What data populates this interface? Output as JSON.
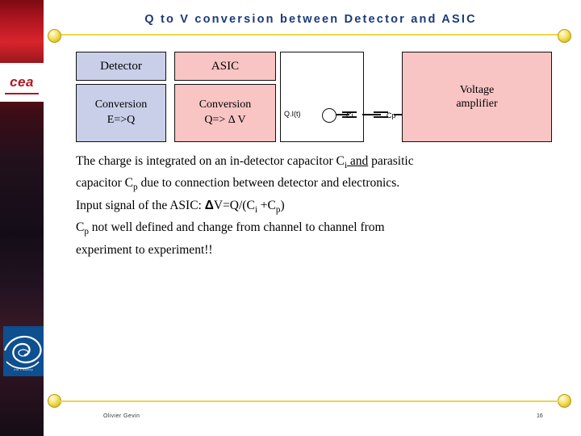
{
  "slide": {
    "title": "Q to V conversion between Detector and ASIC",
    "footer_author": "Olivier Gevin",
    "footer_page": "16"
  },
  "branding": {
    "cea_logo_text": "cea",
    "irfu_caption": "irfu    •    saclay"
  },
  "diagram": {
    "detector_header": "Detector",
    "asic_header": "ASIC",
    "detector_body_line1": "Conversion",
    "detector_body_line2": "E=>Q",
    "asic_body_line1": "Conversion",
    "asic_body_line2": "Q=> Δ V",
    "voltage_amp_line1": "Voltage",
    "voltage_amp_line2": "amplifier",
    "current_source_label": "Q.I(t)",
    "cap_i_label": "Ci",
    "cap_p_label": "Cp"
  },
  "body": {
    "p1_a": "The charge is integrated on an in-detector capacitor C",
    "p1_sub1": "i",
    "p1_b": " and",
    "p1_c": " parasitic",
    "p2_a": "capacitor C",
    "p2_sub": "p",
    "p2_b": " due to connection between detector and electronics.",
    "p3_a": "Input signal of the ASIC: ",
    "p3_delta": "Δ",
    "p3_b": "V=Q/(C",
    "p3_sub1": "i",
    "p3_c": " +C",
    "p3_sub2": "p",
    "p3_d": ")",
    "p4_a": "C",
    "p4_sub": "p",
    "p4_b": " not well defined and change from channel to channel from",
    "p5": "experiment to experiment!!"
  },
  "colors": {
    "title": "#1b3a7a",
    "rule": "#e8d84a",
    "box_blue": "#c9cfe8",
    "box_pink": "#f8c4c4",
    "band_red": "#b21620"
  }
}
